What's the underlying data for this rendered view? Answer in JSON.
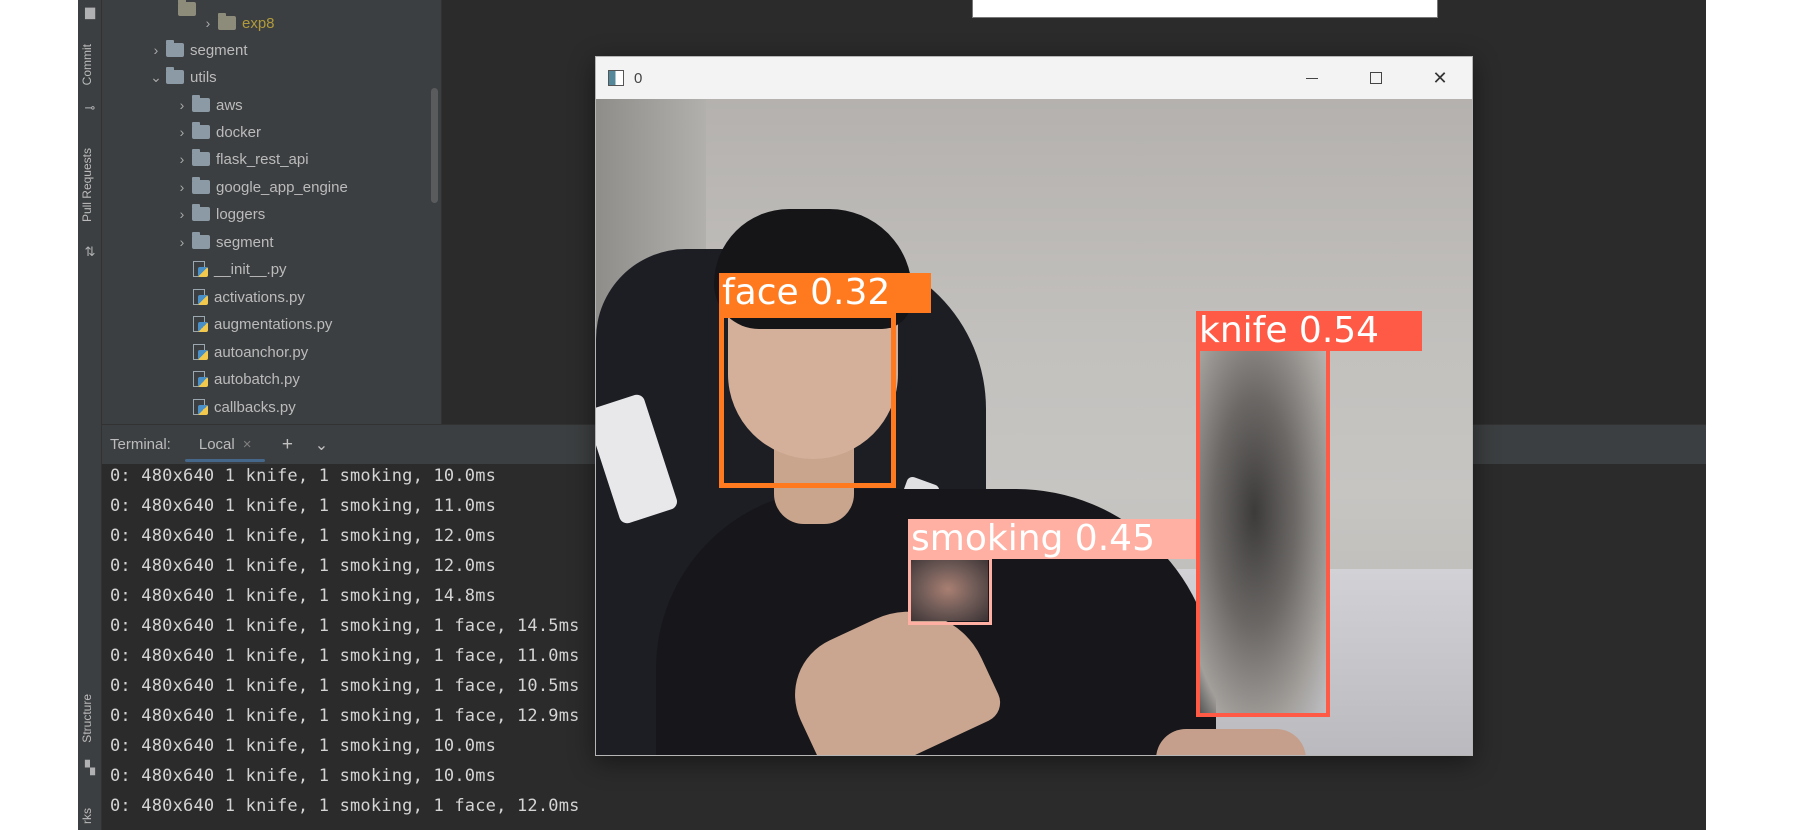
{
  "project_tree": {
    "items": [
      {
        "label": "exp8",
        "type": "folder",
        "chevron": "›",
        "state": "excluded"
      },
      {
        "label": "segment",
        "type": "folder",
        "chevron": "›"
      },
      {
        "label": "utils",
        "type": "folder",
        "chevron": "⌄"
      },
      {
        "label": "aws",
        "type": "folder",
        "chevron": "›"
      },
      {
        "label": "docker",
        "type": "folder",
        "chevron": "›"
      },
      {
        "label": "flask_rest_api",
        "type": "folder",
        "chevron": "›"
      },
      {
        "label": "google_app_engine",
        "type": "folder",
        "chevron": "›"
      },
      {
        "label": "loggers",
        "type": "folder",
        "chevron": "›"
      },
      {
        "label": "segment",
        "type": "folder",
        "chevron": "›"
      },
      {
        "label": "__init__.py",
        "type": "python-file"
      },
      {
        "label": "activations.py",
        "type": "python-file"
      },
      {
        "label": "augmentations.py",
        "type": "python-file"
      },
      {
        "label": "autoanchor.py",
        "type": "python-file"
      },
      {
        "label": "autobatch.py",
        "type": "python-file"
      },
      {
        "label": "callbacks.py",
        "type": "python-file"
      }
    ]
  },
  "left_strip": {
    "commit_label": "Commit",
    "pull_requests_label": "Pull Requests",
    "structure_label": "Structure",
    "bookmarks_label": "rks"
  },
  "terminal": {
    "title": "Terminal:",
    "tab_label": "Local",
    "tab_close": "×",
    "new_tab": "+",
    "more": "⌄",
    "lines": [
      "0: 480x640 1 knife, 1 smoking, 10.0ms",
      "0: 480x640 1 knife, 1 smoking, 11.0ms",
      "0: 480x640 1 knife, 1 smoking, 12.0ms",
      "0: 480x640 1 knife, 1 smoking, 12.0ms",
      "0: 480x640 1 knife, 1 smoking, 14.8ms",
      "0: 480x640 1 knife, 1 smoking, 1 face, 14.5ms",
      "0: 480x640 1 knife, 1 smoking, 1 face, 11.0ms",
      "0: 480x640 1 knife, 1 smoking, 1 face, 10.5ms",
      "0: 480x640 1 knife, 1 smoking, 1 face, 12.9ms",
      "0: 480x640 1 knife, 1 smoking, 10.0ms",
      "0: 480x640 1 knife, 1 smoking, 10.0ms",
      "0: 480x640 1 knife, 1 smoking, 1 face, 12.0ms"
    ]
  },
  "cv_window": {
    "title": "0",
    "minimize_icon": "minimize-icon",
    "maximize_icon": "maximize-icon",
    "close_icon": "close-icon",
    "close_glyph": "✕",
    "detections": [
      {
        "label": "face 0.32",
        "color": "#ff7a1f"
      },
      {
        "label": "knife 0.54",
        "color": "#ff5a45"
      },
      {
        "label": "smoking 0.45",
        "color": "#ffb0a2"
      }
    ]
  },
  "colors": {
    "ide_background": "#2b2b2b",
    "panel": "#3c3f41",
    "text": "#bbbbbb",
    "excluded_folder_text": "#b09a3a",
    "face_box": "#ff7a1f",
    "knife_box": "#ff5a45",
    "smoking_box": "#ffb0a2"
  }
}
